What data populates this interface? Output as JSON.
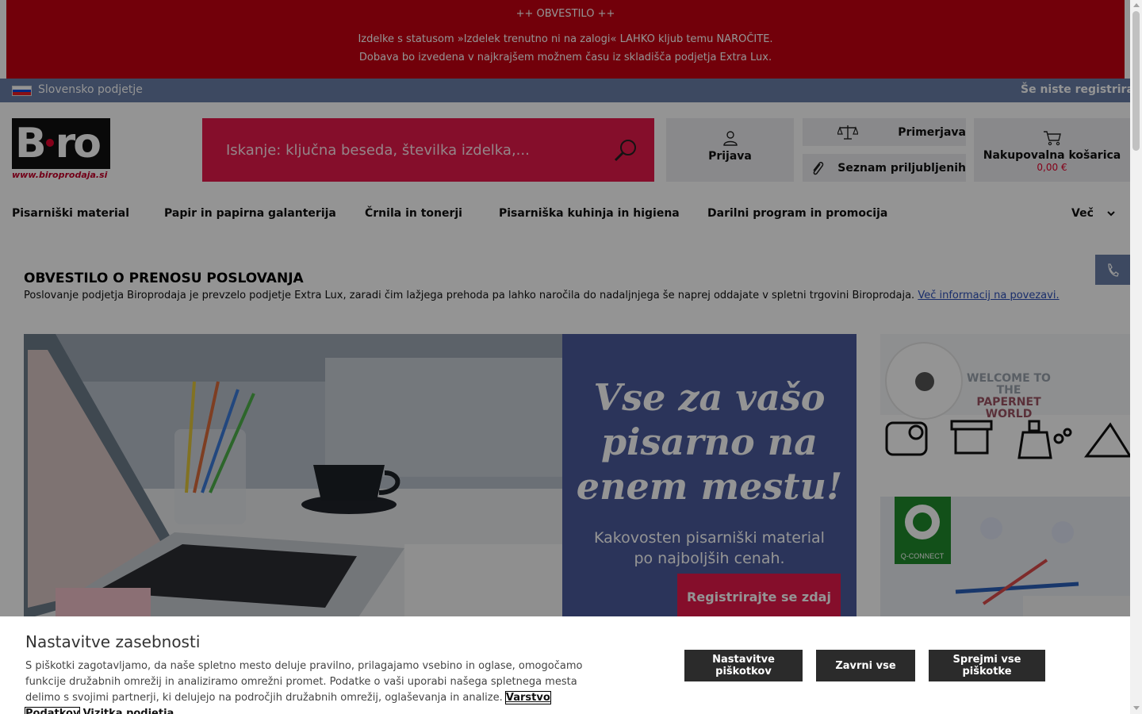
{
  "notice": {
    "title": "++ OBVESTILO ++",
    "line1": "Izdelke s statusom »Izdelek trenutno ni na zalogi« LAHKO kljub temu NAROČITE.",
    "line2": "Dobava bo izvedena v najkrajšem možnem času iz skladišča podjetja Extra Lux."
  },
  "topbar": {
    "country": "Slovensko podjetje",
    "register": "Še niste registrirani"
  },
  "logo": {
    "url_text": "www.biroprodaja.si"
  },
  "search": {
    "placeholder": "Iskanje: ključna beseda, številka izdelka,..."
  },
  "header": {
    "login": "Prijava",
    "compare": "Primerjava",
    "wishlist": "Seznam priljubljenih",
    "cart_label": "Nakupovalna košarica",
    "cart_total": "0,00 €"
  },
  "nav": {
    "items": [
      "Pisarniški material",
      "Papir in papirna galanterija",
      "Črnila in tonerji",
      "Pisarniška kuhinja in higiena",
      "Darilni program in promocija"
    ],
    "more": "Več"
  },
  "announcement": {
    "title": "OBVESTILO O PRENOSU POSLOVANJA",
    "text": "Poslovanje podjetja Biroprodaja je prevzelo podjetje Extra Lux, zaradi čim lažjega prehoda pa lahko naročila do nadaljnjega še naprej oddajate v spletni trgovini Biroprodaja. ",
    "link": "Več informacij na povezavi."
  },
  "hero": {
    "headline_1": "Vse za vašo",
    "headline_2": "pisarno na",
    "headline_3": "enem mestu!",
    "sub_1": "Kakovosten pisarniški material",
    "sub_2": "po najboljših cenah.",
    "cta": "Registrirajte se zdaj"
  },
  "promo1": {
    "line1": "WELCOME TO THE",
    "line2": "PAPERNET WORLD"
  },
  "promo2": {
    "badge": "Q-CONNECT"
  },
  "cookie": {
    "title": "Nastavitve zasebnosti",
    "text": "S piškotki zagotavljamo, da naše spletno mesto deluje pravilno, prilagajamo vsebino in oglase, omogočamo funkcije družabnih omrežij in analiziramo omrežni promet. Podatke o vaši uporabi našega spletnega mesta delimo s svojimi partnerji, ki delujejo na področjih družabnih omrežij, oglaševanja in analize. ",
    "link_privacy": "Varstvo Podatkov",
    "link_company": "Vizitka podjetja",
    "btn_settings": "Nastavitve piškotkov",
    "btn_reject": "Zavrni vse",
    "btn_accept": "Sprejmi vse piškotke"
  },
  "colors": {
    "notice_bg": "#c40012",
    "topbar_bg": "#6a7fa8",
    "search_bg": "#e6194b",
    "hero_panel": "#4a5b9c",
    "cookie_button": "#2b2b2b"
  }
}
